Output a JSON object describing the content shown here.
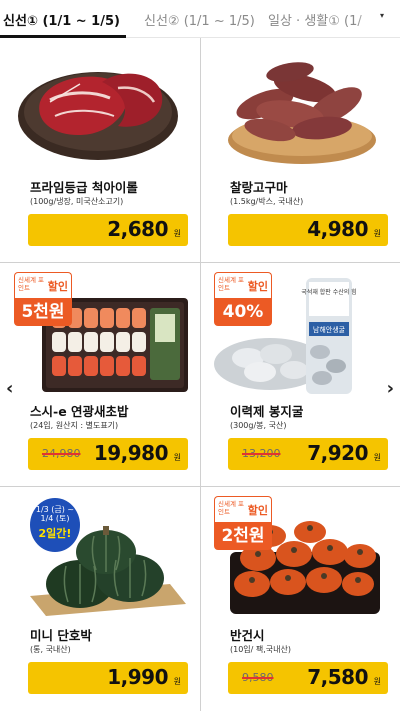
{
  "tabs": [
    {
      "label": "신선① (1/1 ~ 1/5)",
      "active": true
    },
    {
      "label": "신선② (1/1 ~ 1/5)",
      "active": false
    },
    {
      "label": "일상 · 생활① (1/",
      "active": false
    }
  ],
  "tab_dropdown_icon": "▾",
  "nav": {
    "prev": "‹",
    "next": "›"
  },
  "products": [
    {
      "name": "프라임등급 척아이롤",
      "spec": "(100g/냉장, 미국산소고기)",
      "price": "2,680",
      "unit": "원",
      "image": "beef-image"
    },
    {
      "name": "찰랑고구마",
      "spec": "(1.5kg/박스, 국내산)",
      "price": "4,980",
      "unit": "원",
      "image": "sweet-potato-image"
    },
    {
      "name": "스시-e 연광새초밥",
      "spec": "(24입, 원산지 : 별도표기)",
      "orig_price": "24,980",
      "price": "19,980",
      "unit": "원",
      "badge": {
        "sub": "신세계 포인트",
        "main": "할인",
        "value": "5천원"
      }
    },
    {
      "name": "이력제 봉지굴",
      "spec": "(300g/봉, 국산)",
      "orig_price": "13,200",
      "price": "7,920",
      "unit": "원",
      "badge": {
        "sub": "신세계 포인트",
        "main": "할인",
        "value": "40%"
      },
      "package": {
        "top": "국석재 합판 수산의 힘",
        "label": "남해안생굴"
      }
    },
    {
      "name": "미니 단호박",
      "spec": "(통, 국내산)",
      "price": "1,990",
      "unit": "원",
      "date_badge": {
        "dates": "1/3 (금) ~ 1/4 (토)",
        "label": "2일간!"
      }
    },
    {
      "name": "반건시",
      "spec": "(10입/ 팩,국내산)",
      "orig_price": "9,580",
      "price": "7,580",
      "unit": "원",
      "badge": {
        "sub": "신세계 포인트",
        "main": "할인",
        "value": "2천원"
      }
    }
  ]
}
